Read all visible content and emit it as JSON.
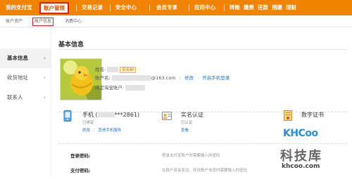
{
  "topnav": {
    "items": [
      "我的支付宝",
      "账户管理",
      "交易记录",
      "安全中心",
      "会员专享",
      "应用中心",
      "转账",
      "缴费",
      "还款",
      "捐缴",
      "理财"
    ]
  },
  "subnav": {
    "items": [
      "账户资产",
      "账户信息",
      "消费中心"
    ]
  },
  "sidebar": {
    "items": [
      "基本信息",
      "收货地址",
      "联系人"
    ]
  },
  "main": {
    "title": "基本信息",
    "profile": {
      "name_label": "姓名:",
      "verified_badge": "实名制",
      "account_label": "账户名:",
      "account_value": "@163.com",
      "edit_link": "修改",
      "phone_login_link": "开启手机登录",
      "taobao_label": "绑定淘宝账户:"
    },
    "cards": {
      "phone": {
        "title": "手机 (",
        "number": "***2861)",
        "status": "已绑定",
        "edit": "修改",
        "service": "其他手机服务"
      },
      "realname": {
        "title": "实名认证",
        "status": "已认证",
        "view": "查看"
      },
      "cert": {
        "title": "数字证书"
      }
    },
    "passwords": {
      "login_label": "登录密码:",
      "login_desc": "登录支付宝账户时需要输入的密码",
      "pay_label": "支付密码:",
      "pay_desc": "在账户资金变动、修改账户信息时需要输入的密码"
    }
  },
  "watermark": {
    "logo": "KHCoo",
    "cn": "科技库",
    "url": "khcoo.com"
  },
  "colors": {
    "accent": "#f08300",
    "link": "#2a72c5",
    "highlight": "#e02020"
  }
}
